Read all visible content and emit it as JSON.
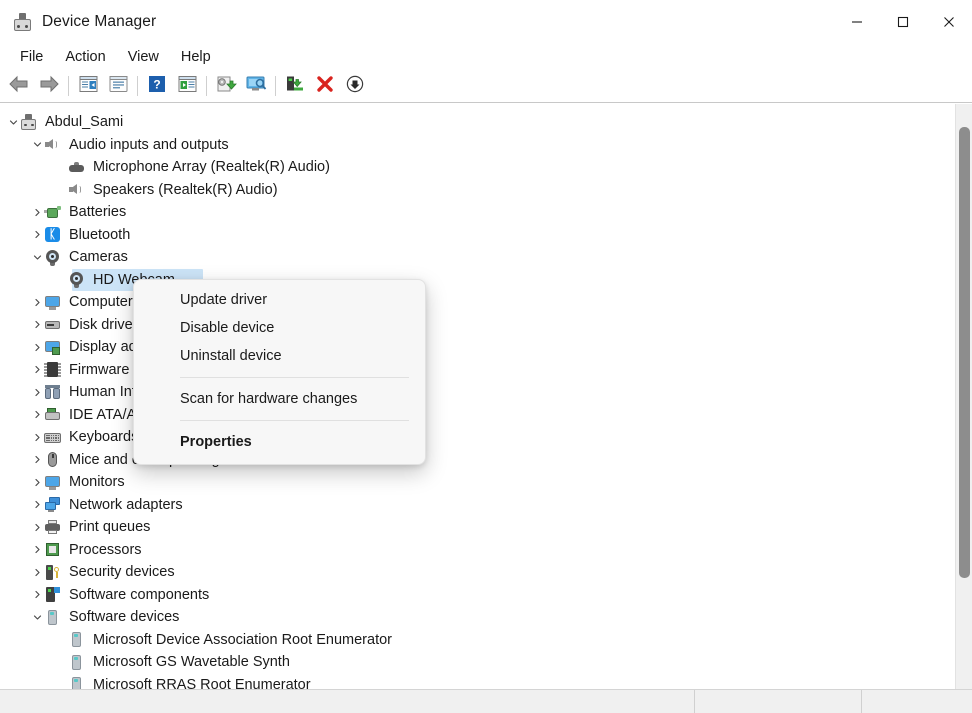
{
  "window": {
    "title": "Device Manager",
    "icon": "device-manager-icon",
    "controls": {
      "minimize": "Minimize",
      "maximize": "Maximize",
      "close": "Close"
    }
  },
  "menubar": {
    "items": [
      {
        "label": "File"
      },
      {
        "label": "Action"
      },
      {
        "label": "View"
      },
      {
        "label": "Help"
      }
    ]
  },
  "toolbar": {
    "buttons": [
      {
        "name": "back-button",
        "icon": "back-arrow-icon"
      },
      {
        "name": "forward-button",
        "icon": "forward-arrow-icon"
      },
      {
        "name": "separator-1",
        "icon": "separator"
      },
      {
        "name": "show-hide-console-tree-button",
        "icon": "console-tree-icon"
      },
      {
        "name": "properties-button",
        "icon": "properties-icon"
      },
      {
        "name": "separator-2",
        "icon": "separator"
      },
      {
        "name": "help-button",
        "icon": "help-question-icon"
      },
      {
        "name": "show-hide-action-pane-button",
        "icon": "action-pane-icon"
      },
      {
        "name": "separator-3",
        "icon": "separator"
      },
      {
        "name": "update-driver-button",
        "icon": "update-driver-icon"
      },
      {
        "name": "scan-for-hardware-changes-button",
        "icon": "scan-hardware-icon"
      },
      {
        "name": "separator-4",
        "icon": "separator"
      },
      {
        "name": "enable-device-button",
        "icon": "enable-device-icon"
      },
      {
        "name": "uninstall-device-button",
        "icon": "red-x-icon"
      },
      {
        "name": "disable-device-button",
        "icon": "down-arrow-circle-icon"
      }
    ]
  },
  "tree": {
    "nodes": [
      {
        "label": "Abdul_Sami",
        "level": 0,
        "expander": "expanded",
        "icon": "computer-root-icon",
        "selected": false
      },
      {
        "label": "Audio inputs and outputs",
        "level": 1,
        "expander": "expanded",
        "icon": "speaker-icon",
        "selected": false
      },
      {
        "label": "Microphone Array (Realtek(R) Audio)",
        "level": 2,
        "expander": "none",
        "icon": "microphone-array-icon",
        "selected": false
      },
      {
        "label": "Speakers (Realtek(R) Audio)",
        "level": 2,
        "expander": "none",
        "icon": "speaker-icon",
        "selected": false
      },
      {
        "label": "Batteries",
        "level": 1,
        "expander": "collapsed",
        "icon": "battery-icon",
        "selected": false
      },
      {
        "label": "Bluetooth",
        "level": 1,
        "expander": "collapsed",
        "icon": "bluetooth-icon",
        "selected": false
      },
      {
        "label": "Cameras",
        "level": 1,
        "expander": "expanded",
        "icon": "camera-icon",
        "selected": false
      },
      {
        "label": "HD Webcam",
        "level": 2,
        "expander": "none",
        "icon": "camera-icon",
        "selected": true
      },
      {
        "label": "Computer",
        "level": 1,
        "expander": "collapsed",
        "icon": "monitor-icon",
        "selected": false
      },
      {
        "label": "Disk drives",
        "level": 1,
        "expander": "collapsed",
        "icon": "disk-drive-icon",
        "selected": false
      },
      {
        "label": "Display adapters",
        "level": 1,
        "expander": "collapsed",
        "icon": "display-adapter-icon",
        "selected": false
      },
      {
        "label": "Firmware",
        "level": 1,
        "expander": "collapsed",
        "icon": "firmware-chip-icon",
        "selected": false
      },
      {
        "label": "Human Interface Devices",
        "level": 1,
        "expander": "collapsed",
        "icon": "human-interface-device-icon",
        "selected": false
      },
      {
        "label": "IDE ATA/ATAPI controllers",
        "level": 1,
        "expander": "collapsed",
        "icon": "ide-controller-icon",
        "selected": false
      },
      {
        "label": "Keyboards",
        "level": 1,
        "expander": "collapsed",
        "icon": "keyboard-icon",
        "selected": false
      },
      {
        "label": "Mice and other pointing devices",
        "level": 1,
        "expander": "collapsed",
        "icon": "mouse-icon",
        "selected": false
      },
      {
        "label": "Monitors",
        "level": 1,
        "expander": "collapsed",
        "icon": "monitor-icon",
        "selected": false
      },
      {
        "label": "Network adapters",
        "level": 1,
        "expander": "collapsed",
        "icon": "network-adapter-icon",
        "selected": false
      },
      {
        "label": "Print queues",
        "level": 1,
        "expander": "collapsed",
        "icon": "printer-icon",
        "selected": false
      },
      {
        "label": "Processors",
        "level": 1,
        "expander": "collapsed",
        "icon": "processor-icon",
        "selected": false
      },
      {
        "label": "Security devices",
        "level": 1,
        "expander": "collapsed",
        "icon": "security-device-icon",
        "selected": false
      },
      {
        "label": "Software components",
        "level": 1,
        "expander": "collapsed",
        "icon": "software-component-icon",
        "selected": false
      },
      {
        "label": "Software devices",
        "level": 1,
        "expander": "expanded",
        "icon": "software-device-icon",
        "selected": false
      },
      {
        "label": "Microsoft Device Association Root Enumerator",
        "level": 2,
        "expander": "none",
        "icon": "software-device-icon",
        "selected": false
      },
      {
        "label": "Microsoft GS Wavetable Synth",
        "level": 2,
        "expander": "none",
        "icon": "software-device-icon",
        "selected": false
      },
      {
        "label": "Microsoft RRAS Root Enumerator",
        "level": 2,
        "expander": "none",
        "icon": "software-device-icon",
        "selected": false
      }
    ],
    "selection_highlight_color": "#cce4f7",
    "selected_label": "HD Webcam"
  },
  "context_menu": {
    "items": [
      {
        "label": "Update driver",
        "type": "item",
        "bold": false
      },
      {
        "label": "Disable device",
        "type": "item",
        "bold": false
      },
      {
        "label": "Uninstall device",
        "type": "item",
        "bold": false
      },
      {
        "label": "",
        "type": "separator",
        "bold": false
      },
      {
        "label": "Scan for hardware changes",
        "type": "item",
        "bold": false
      },
      {
        "label": "",
        "type": "separator",
        "bold": false
      },
      {
        "label": "Properties",
        "type": "item",
        "bold": true
      }
    ]
  },
  "statusbar": {
    "cells": [
      "",
      "",
      ""
    ]
  },
  "scrollbar": {
    "orientation": "vertical",
    "thumb_top_pct": 4,
    "thumb_height_pct": 77
  }
}
